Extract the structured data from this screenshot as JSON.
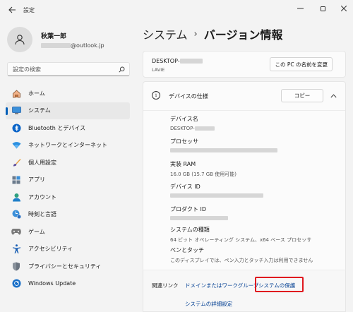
{
  "window": {
    "title": "設定",
    "back_icon": "arrow-left-icon",
    "minimize_icon": "minimize-icon",
    "maximize_icon": "maximize-icon",
    "close_icon": "close-icon"
  },
  "profile": {
    "name": "秋葉一郎",
    "email_domain": "@outlook.jp",
    "avatar_icon": "user-avatar-icon"
  },
  "search": {
    "placeholder": "設定の検索",
    "icon": "search-icon"
  },
  "sidebar": {
    "items": [
      {
        "label": "ホーム",
        "icon": "home-icon"
      },
      {
        "label": "システム",
        "icon": "system-display-icon",
        "active": true
      },
      {
        "label": "Bluetooth とデバイス",
        "icon": "bluetooth-icon"
      },
      {
        "label": "ネットワークとインターネット",
        "icon": "wifi-icon"
      },
      {
        "label": "個人用設定",
        "icon": "brush-icon"
      },
      {
        "label": "アプリ",
        "icon": "apps-icon"
      },
      {
        "label": "アカウント",
        "icon": "account-icon"
      },
      {
        "label": "時刻と言語",
        "icon": "time-language-icon"
      },
      {
        "label": "ゲーム",
        "icon": "gamepad-icon"
      },
      {
        "label": "アクセシビリティ",
        "icon": "accessibility-icon"
      },
      {
        "label": "プライバシーとセキュリティ",
        "icon": "shield-icon"
      },
      {
        "label": "Windows Update",
        "icon": "windows-update-icon"
      }
    ]
  },
  "header": {
    "parent": "システム",
    "separator": "›",
    "current": "バージョン情報"
  },
  "device": {
    "name_prefix": "DESKTOP-",
    "model": "LAVIE",
    "rename_label": "この PC の名前を変更"
  },
  "specs": {
    "title": "デバイスの仕様",
    "copy_label": "コピー",
    "info_icon": "info-icon",
    "collapse_icon": "chevron-up-icon",
    "rows": [
      {
        "label": "デバイス名",
        "value": "DESKTOP-"
      },
      {
        "label": "プロセッサ",
        "value": ""
      },
      {
        "label": "実装 RAM",
        "value": "16.0 GB (15.7 GB 使用可能)"
      },
      {
        "label": "デバイス ID",
        "value": ""
      },
      {
        "label": "プロダクト ID",
        "value": ""
      },
      {
        "label": "システムの種類",
        "value": "64 ビット オペレーティング システム、x64 ベース プロセッサ"
      },
      {
        "label": "ペンとタッチ",
        "value": "このディスプレイでは、ペン入力とタッチ入力は利用できません"
      }
    ]
  },
  "related": {
    "label": "関連リンク",
    "links": [
      "ドメインまたはワークグループ",
      "システムの保護",
      "システムの詳細設定"
    ],
    "highlight_color": "#e0181f"
  },
  "colors": {
    "accent": "#005fb8",
    "link": "#003e92",
    "background": "#f3f3f3"
  }
}
